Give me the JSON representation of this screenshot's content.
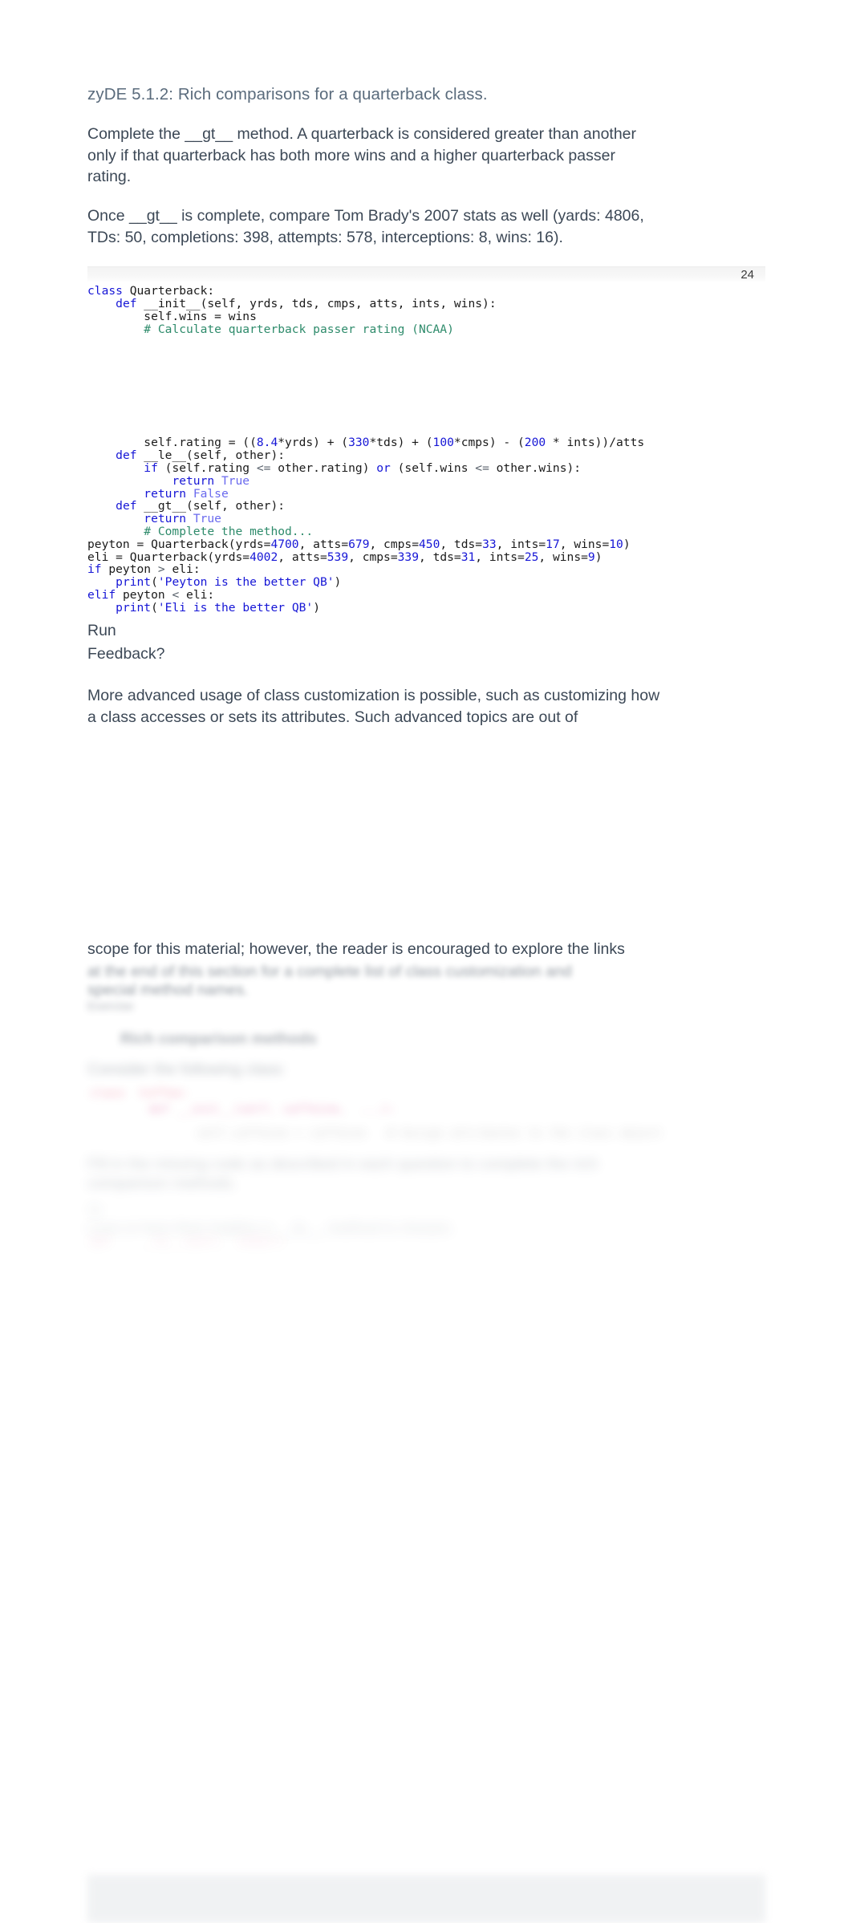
{
  "document": {
    "title": "zyDE 5.1.2: Rich comparisons for a quarterback class."
  },
  "instructions": {
    "paragraph_1": "Complete the __gt__ method. A quarterback is considered greater than another only if that quarterback has both more wins and a higher quarterback passer rating.",
    "paragraph_2": "Once __gt__ is complete, compare Tom Brady's 2007 stats as well (yards: 4806, TDs: 50, completions: 398, attempts: 578, interceptions: 8, wins: 16)."
  },
  "code_widget": {
    "line_counter": "24",
    "lines": [
      {
        "id": 1,
        "segments": [
          {
            "t": "class",
            "c": "kw"
          },
          {
            "t": " Quarterback:",
            "c": "pl"
          }
        ]
      },
      {
        "id": 2,
        "segments": [
          {
            "t": "    ",
            "c": "pl"
          },
          {
            "t": "def",
            "c": "kw"
          },
          {
            "t": " __init__(self, yrds, tds, cmps, atts, ints, wins):",
            "c": "pl"
          }
        ]
      },
      {
        "id": 3,
        "segments": [
          {
            "t": "        self.wins = wins",
            "c": "pl"
          }
        ]
      },
      {
        "id": 4,
        "segments": [
          {
            "t": "        # Calculate quarterback passer rating (NCAA)",
            "c": "cm"
          }
        ]
      },
      {
        "id": 5,
        "segments": [
          {
            "t": "",
            "c": "pl"
          }
        ]
      },
      {
        "id": 6,
        "segments": [
          {
            "t": "        self.rating = ((",
            "c": "pl"
          },
          {
            "t": "8.4",
            "c": "num"
          },
          {
            "t": "*yrds) + (",
            "c": "pl"
          },
          {
            "t": "330",
            "c": "num"
          },
          {
            "t": "*tds) + (",
            "c": "pl"
          },
          {
            "t": "100",
            "c": "num"
          },
          {
            "t": "*cmps) - (",
            "c": "pl"
          },
          {
            "t": "200",
            "c": "num"
          },
          {
            "t": " * ints))/atts",
            "c": "pl"
          }
        ]
      },
      {
        "id": 7,
        "segments": [
          {
            "t": "    ",
            "c": "pl"
          },
          {
            "t": "def",
            "c": "kw"
          },
          {
            "t": " __le__(self, other):",
            "c": "pl"
          }
        ]
      },
      {
        "id": 8,
        "segments": [
          {
            "t": "        ",
            "c": "pl"
          },
          {
            "t": "if",
            "c": "kw"
          },
          {
            "t": " (self.rating ",
            "c": "pl"
          },
          {
            "t": "<=",
            "c": "op"
          },
          {
            "t": " other.rating) ",
            "c": "pl"
          },
          {
            "t": "or",
            "c": "kw"
          },
          {
            "t": " (self.wins ",
            "c": "pl"
          },
          {
            "t": "<=",
            "c": "op"
          },
          {
            "t": " other.wins):",
            "c": "pl"
          }
        ]
      },
      {
        "id": 9,
        "segments": [
          {
            "t": "            ",
            "c": "pl"
          },
          {
            "t": "return",
            "c": "kw"
          },
          {
            "t": " ",
            "c": "pl"
          },
          {
            "t": "True",
            "c": "bool"
          }
        ]
      },
      {
        "id": 10,
        "segments": [
          {
            "t": "        ",
            "c": "pl"
          },
          {
            "t": "return",
            "c": "kw"
          },
          {
            "t": " ",
            "c": "pl"
          },
          {
            "t": "False",
            "c": "bool"
          }
        ]
      },
      {
        "id": 11,
        "segments": [
          {
            "t": "    ",
            "c": "pl"
          },
          {
            "t": "def",
            "c": "kw"
          },
          {
            "t": " __gt__(self, other):",
            "c": "pl"
          }
        ]
      },
      {
        "id": 12,
        "segments": [
          {
            "t": "        ",
            "c": "pl"
          },
          {
            "t": "return",
            "c": "kw"
          },
          {
            "t": " ",
            "c": "pl"
          },
          {
            "t": "True",
            "c": "bool"
          }
        ]
      },
      {
        "id": 13,
        "segments": [
          {
            "t": "        # Complete the method...",
            "c": "cm"
          }
        ]
      },
      {
        "id": 14,
        "segments": [
          {
            "t": "peyton = Quarterback(yrds=",
            "c": "pl"
          },
          {
            "t": "4700",
            "c": "num"
          },
          {
            "t": ", atts=",
            "c": "pl"
          },
          {
            "t": "679",
            "c": "num"
          },
          {
            "t": ", cmps=",
            "c": "pl"
          },
          {
            "t": "450",
            "c": "num"
          },
          {
            "t": ", tds=",
            "c": "pl"
          },
          {
            "t": "33",
            "c": "num"
          },
          {
            "t": ", ints=",
            "c": "pl"
          },
          {
            "t": "17",
            "c": "num"
          },
          {
            "t": ", wins=",
            "c": "pl"
          },
          {
            "t": "10",
            "c": "num"
          },
          {
            "t": ")",
            "c": "pl"
          }
        ]
      },
      {
        "id": 15,
        "segments": [
          {
            "t": "eli = Quarterback(yrds=",
            "c": "pl"
          },
          {
            "t": "4002",
            "c": "num"
          },
          {
            "t": ", atts=",
            "c": "pl"
          },
          {
            "t": "539",
            "c": "num"
          },
          {
            "t": ", cmps=",
            "c": "pl"
          },
          {
            "t": "339",
            "c": "num"
          },
          {
            "t": ", tds=",
            "c": "pl"
          },
          {
            "t": "31",
            "c": "num"
          },
          {
            "t": ", ints=",
            "c": "pl"
          },
          {
            "t": "25",
            "c": "num"
          },
          {
            "t": ", wins=",
            "c": "pl"
          },
          {
            "t": "9",
            "c": "num"
          },
          {
            "t": ")",
            "c": "pl"
          }
        ]
      },
      {
        "id": 16,
        "segments": [
          {
            "t": "if",
            "c": "kw"
          },
          {
            "t": " peyton ",
            "c": "pl"
          },
          {
            "t": ">",
            "c": "op"
          },
          {
            "t": " eli:",
            "c": "pl"
          }
        ]
      },
      {
        "id": 17,
        "segments": [
          {
            "t": "    ",
            "c": "pl"
          },
          {
            "t": "print",
            "c": "fn"
          },
          {
            "t": "(",
            "c": "pl"
          },
          {
            "t": "'Peyton is the better QB'",
            "c": "str"
          },
          {
            "t": ")",
            "c": "pl"
          }
        ]
      },
      {
        "id": 18,
        "segments": [
          {
            "t": "elif",
            "c": "kw"
          },
          {
            "t": " peyton ",
            "c": "pl"
          },
          {
            "t": "<",
            "c": "op"
          },
          {
            "t": " eli:",
            "c": "pl"
          }
        ]
      },
      {
        "id": 19,
        "segments": [
          {
            "t": "    ",
            "c": "pl"
          },
          {
            "t": "print",
            "c": "fn"
          },
          {
            "t": "(",
            "c": "pl"
          },
          {
            "t": "'Eli is the better QB'",
            "c": "str"
          },
          {
            "t": ")",
            "c": "pl"
          }
        ]
      }
    ],
    "run_label": "Run",
    "feedback_label": "Feedback?"
  },
  "closing": {
    "paragraph_1": "More advanced usage of class customization is possible, such as customizing how a class accesses or sets its attributes. Such advanced topics are out of",
    "paragraph_2": "scope for this material; however, the reader is encouraged to explore the links"
  },
  "tail": {
    "blurred_1": "at the end of this section for a complete list of class customization and",
    "blurred_2": "special method names.",
    "blurred_3": "Exercise",
    "blurred_4": "Rich comparison methods",
    "blurred_5": "Consider the following class:",
    "blurred_code_1": "class  Coffee:",
    "blurred_code_2": "    def __init__(self, caffeine,  ...):",
    "blurred_code_3": "        self.caffeine = caffeine   # Assign attributes to the class object",
    "blurred_6": "Fill in the missing code as described in each question to complete the rich",
    "blurred_7": "comparison methods.",
    "blurred_8": "1)",
    "blurred_9": "Less or less than implies a __le__ method is chosen.",
    "blurred_code_4": "def    __le__(self,  other):"
  }
}
